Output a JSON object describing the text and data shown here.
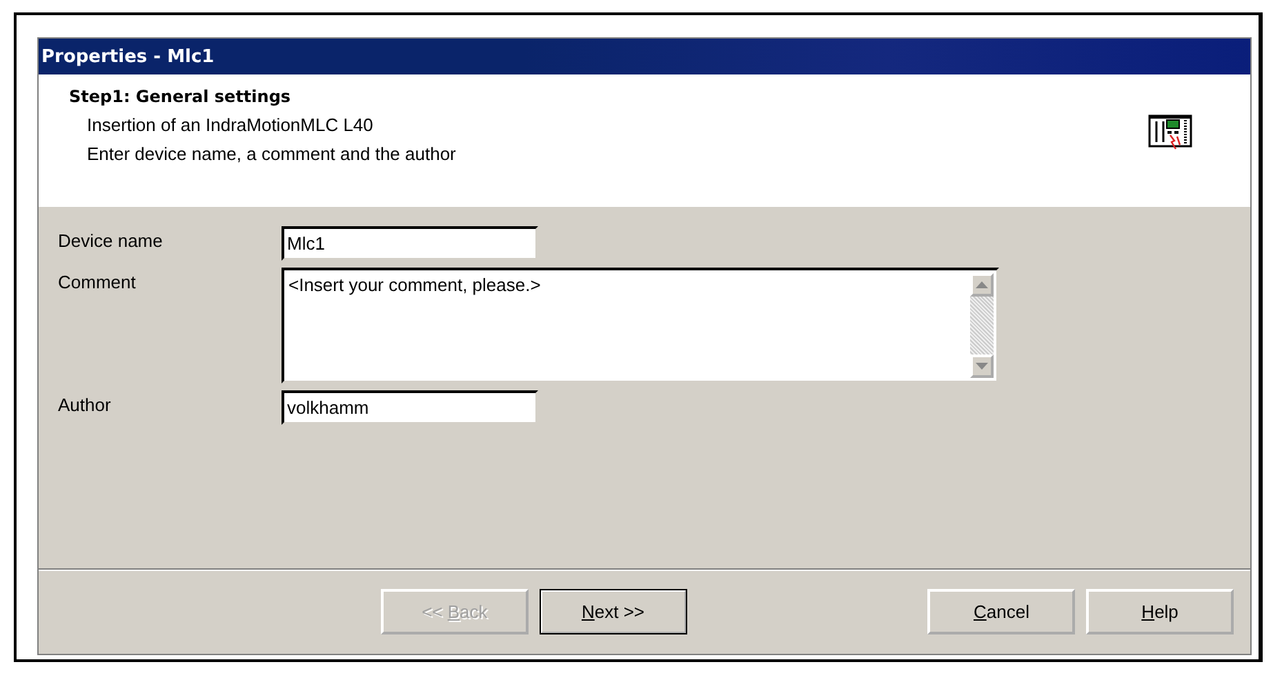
{
  "window": {
    "title": "Properties - Mlc1"
  },
  "header": {
    "step": "Step1: General settings",
    "lines": [
      "Insertion of an IndraMotionMLC L40",
      "Enter device name, a comment and the author"
    ]
  },
  "fields": [
    {
      "kind": "line",
      "label": "Device name",
      "value": "Mlc1"
    },
    {
      "kind": "memo",
      "label": "Comment",
      "value": "<Insert your comment, please.>"
    },
    {
      "kind": "line",
      "label": "Author",
      "value": "volkhamm"
    }
  ],
  "buttons": [
    {
      "pre": "<< ",
      "key": "B",
      "post": "ack",
      "disabled": true,
      "default": false
    },
    {
      "key": "N",
      "post": "ext >>",
      "disabled": false,
      "default": true
    },
    {
      "key": "C",
      "post": "ancel",
      "disabled": false,
      "default": false
    },
    {
      "key": "H",
      "post": "elp",
      "disabled": false,
      "default": false
    }
  ]
}
